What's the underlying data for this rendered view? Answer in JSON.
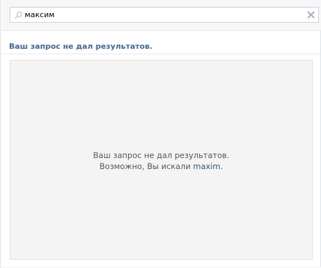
{
  "search": {
    "query": "максим",
    "icon": "search-icon",
    "clear_icon": "close-icon"
  },
  "results": {
    "header": "Ваш запрос не дал результатов.",
    "empty_message": "Ваш запрос не дал результатов.",
    "suggestion_prefix": "Возможно, Вы искали",
    "suggestion_link": "maxim",
    "suggestion_suffix": "."
  },
  "colors": {
    "accent": "#45688e",
    "link": "#2b587a",
    "panel_bg": "#f4f4f4",
    "text_muted": "#555555"
  }
}
